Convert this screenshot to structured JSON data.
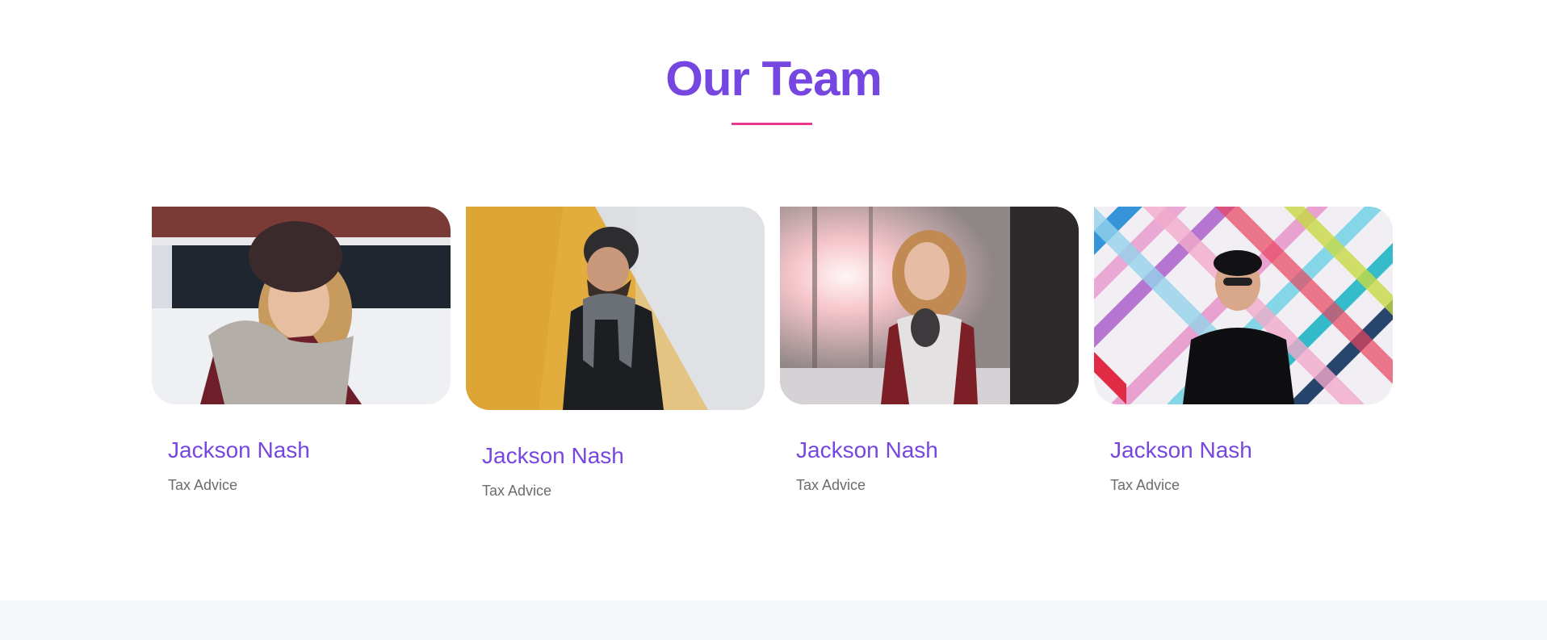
{
  "section": {
    "title": "Our Team"
  },
  "team": [
    {
      "name": "Jackson Nash",
      "role": "Tax Advice",
      "photo_subject": "woman in beanie and scarf in snow",
      "photo_icon": "portrait-image"
    },
    {
      "name": "Jackson Nash",
      "role": "Tax Advice",
      "photo_subject": "bearded man with glasses against yellow and white wall",
      "photo_icon": "portrait-image"
    },
    {
      "name": "Jackson Nash",
      "role": "Tax Advice",
      "photo_subject": "woman with scarf in sunlit winter forest",
      "photo_icon": "portrait-image"
    },
    {
      "name": "Jackson Nash",
      "role": "Tax Advice",
      "photo_subject": "man in cap and sunglasses against colorful striped mural",
      "photo_icon": "portrait-image"
    }
  ],
  "colors": {
    "accent": "#7647e0",
    "underline": "#e9398c",
    "muted_text": "#6c6c6c",
    "footer_bg": "#f4f7fa"
  }
}
